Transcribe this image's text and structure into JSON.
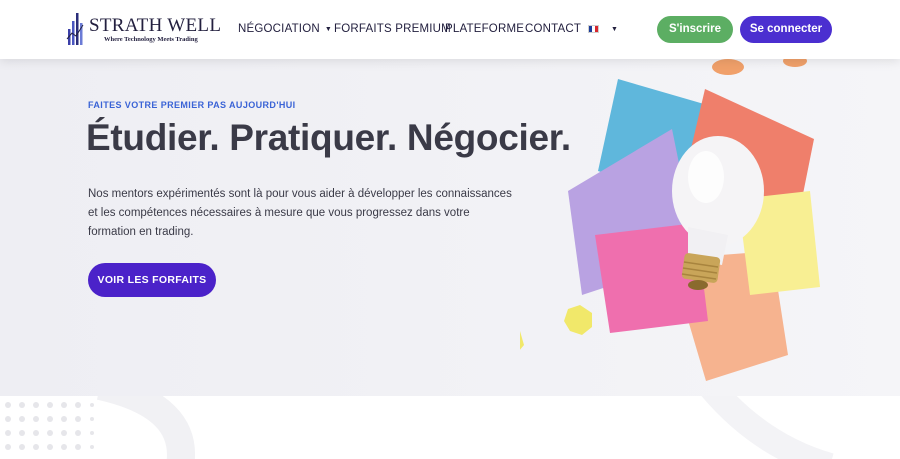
{
  "brand": {
    "name": "STRATH WELL",
    "tagline": "Where Technology Meets Trading",
    "logo_icon": "bar-chart-logo-icon",
    "colors": {
      "primary": "#4b2fd0",
      "success": "#5cae63",
      "eyebrow": "#3a63d6",
      "text": "#3a3a47"
    }
  },
  "nav": {
    "items": [
      {
        "label": "NÉGOCIATION",
        "has_dropdown": true
      },
      {
        "label": "FORFAITS PREMIUM",
        "has_dropdown": false
      },
      {
        "label": "PLATEFORME",
        "has_dropdown": false
      },
      {
        "label": "CONTACT",
        "has_dropdown": false
      }
    ],
    "language_flag": "french-flag-icon",
    "signup_label": "S'inscrire",
    "login_label": "Se connecter"
  },
  "hero": {
    "eyebrow": "FAITES VOTRE PREMIER PAS AUJOURD'HUI",
    "headline": "Étudier. Pratiquer. Négocier.",
    "description": "Nos mentors expérimentés sont là pour vous aider à développer les connaissances et les compétences nécessaires à mesure que vous progressez dans votre formation en trading.",
    "cta_label": "VOIR LES FORFAITS",
    "image": "sticky-notes-lightbulb-illustration"
  }
}
